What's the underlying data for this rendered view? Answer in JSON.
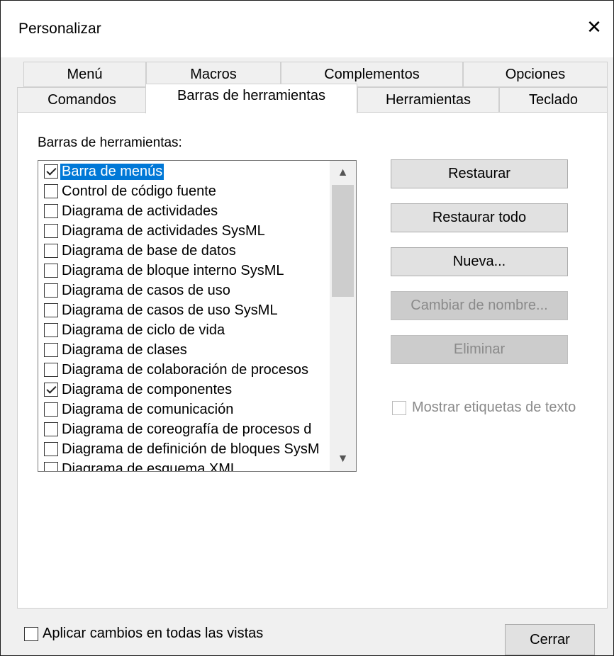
{
  "window": {
    "title": "Personalizar",
    "close_glyph": "✕"
  },
  "tabs_row1": [
    "Menú",
    "Macros",
    "Complementos",
    "Opciones"
  ],
  "tabs_row2": [
    "Comandos",
    "Barras de herramientas",
    "Herramientas",
    "Teclado"
  ],
  "active_tab": "Barras de herramientas",
  "group_label": "Barras de herramientas:",
  "toolbars": [
    {
      "label": "Barra de menús",
      "checked": true,
      "selected": true
    },
    {
      "label": "Control de código fuente",
      "checked": false
    },
    {
      "label": "Diagrama de actividades",
      "checked": false
    },
    {
      "label": "Diagrama de actividades SysML",
      "checked": false
    },
    {
      "label": "Diagrama de base de datos",
      "checked": false
    },
    {
      "label": "Diagrama de bloque interno SysML",
      "checked": false
    },
    {
      "label": "Diagrama de casos de uso",
      "checked": false
    },
    {
      "label": "Diagrama de casos de uso SysML",
      "checked": false
    },
    {
      "label": "Diagrama de ciclo de vida",
      "checked": false
    },
    {
      "label": "Diagrama de clases",
      "checked": false
    },
    {
      "label": "Diagrama de colaboración de procesos",
      "checked": false
    },
    {
      "label": "Diagrama de componentes",
      "checked": true
    },
    {
      "label": "Diagrama de comunicación",
      "checked": false
    },
    {
      "label": "Diagrama de coreografía de procesos d",
      "checked": false
    },
    {
      "label": "Diagrama de definición de bloques SysM",
      "checked": false
    },
    {
      "label": "Diagrama de esquema XML",
      "checked": false
    }
  ],
  "scroll": {
    "up_glyph": "▲",
    "down_glyph": "▼"
  },
  "buttons": {
    "restore": "Restaurar",
    "restore_all": "Restaurar todo",
    "new": "Nueva...",
    "rename": "Cambiar de nombre...",
    "delete": "Eliminar"
  },
  "show_text_labels": {
    "label": "Mostrar etiquetas de texto",
    "checked": false
  },
  "apply_all": {
    "label": "Aplicar cambios en todas las vistas",
    "checked": false
  },
  "close_button": "Cerrar"
}
